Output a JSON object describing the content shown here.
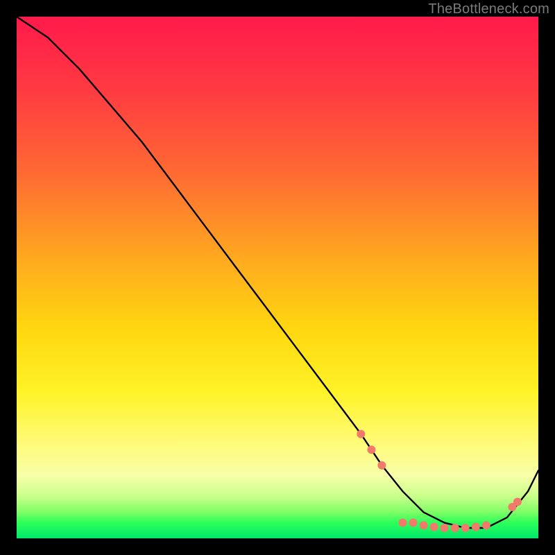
{
  "watermark": "TheBottleneck.com",
  "chart_data": {
    "type": "line",
    "title": "",
    "xlabel": "",
    "ylabel": "",
    "xlim": [
      0,
      100
    ],
    "ylim": [
      0,
      100
    ],
    "series": [
      {
        "name": "curve",
        "x": [
          0,
          6,
          12,
          18,
          24,
          30,
          36,
          42,
          48,
          54,
          60,
          66,
          70,
          74,
          78,
          82,
          86,
          90,
          94,
          98,
          100
        ],
        "y": [
          100,
          96,
          90,
          83,
          76,
          68,
          60,
          52,
          44,
          36,
          28,
          20,
          14,
          9,
          5,
          3,
          2,
          2,
          4,
          9,
          13
        ]
      }
    ],
    "markers": [
      {
        "x": 66,
        "y": 20
      },
      {
        "x": 68,
        "y": 17
      },
      {
        "x": 70,
        "y": 14
      },
      {
        "x": 74,
        "y": 3
      },
      {
        "x": 76,
        "y": 3
      },
      {
        "x": 78,
        "y": 2.5
      },
      {
        "x": 80,
        "y": 2.2
      },
      {
        "x": 82,
        "y": 2
      },
      {
        "x": 84,
        "y": 2
      },
      {
        "x": 86,
        "y": 2
      },
      {
        "x": 88,
        "y": 2.2
      },
      {
        "x": 90,
        "y": 2.5
      },
      {
        "x": 95,
        "y": 6
      },
      {
        "x": 96,
        "y": 7
      }
    ],
    "marker_color": "#f27a6a",
    "curve_color": "#000000"
  }
}
